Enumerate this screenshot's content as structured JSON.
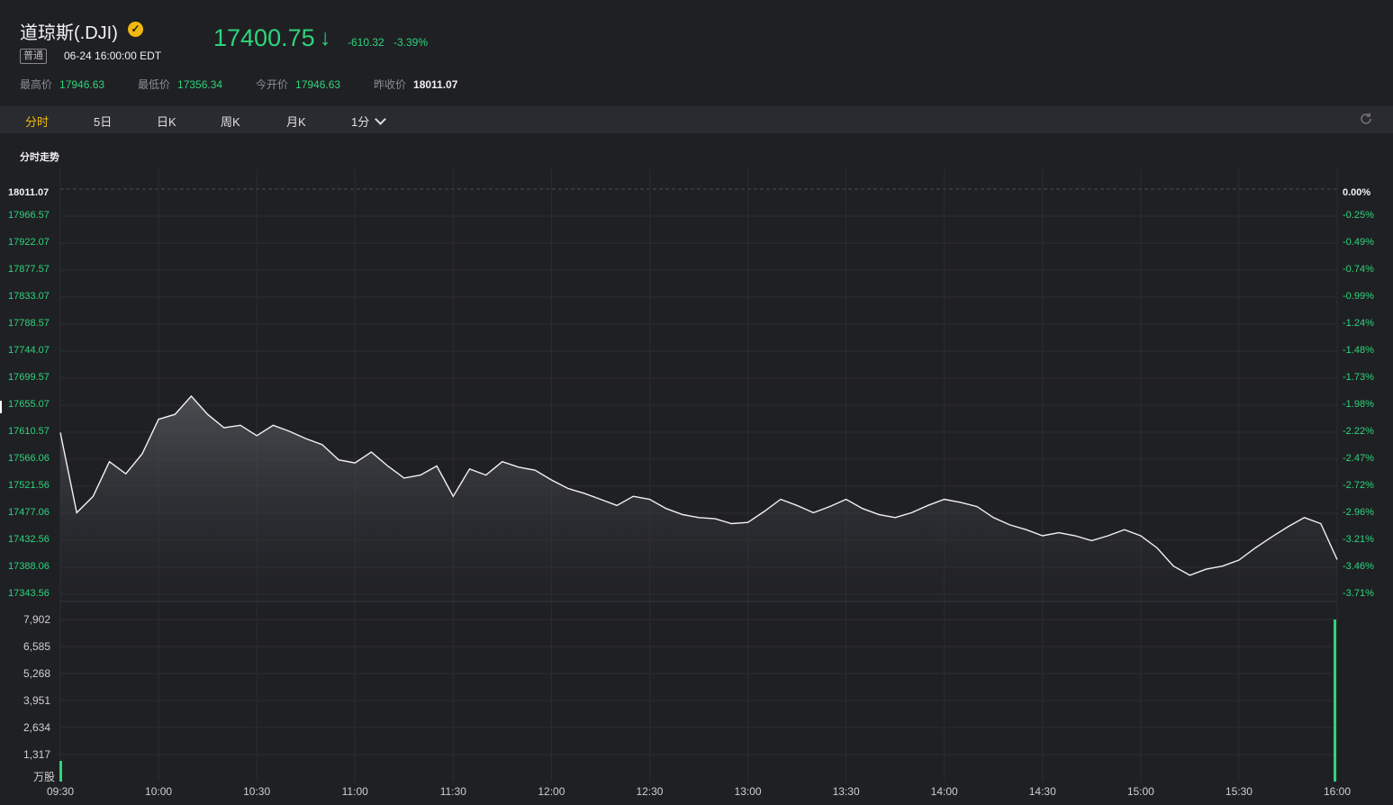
{
  "stock": {
    "name": "道琼斯(.DJI)",
    "tag": "普通",
    "datetime": "06-24 16:00:00 EDT",
    "price": "17400.75",
    "change": "-610.32",
    "change_pct": "-3.39%",
    "arrow": "↓"
  },
  "stats": [
    {
      "label": "最高价",
      "value": "17946.63"
    },
    {
      "label": "最低价",
      "value": "17356.34"
    },
    {
      "label": "今开价",
      "value": "17946.63"
    },
    {
      "label": "昨收价",
      "value": "18011.07"
    }
  ],
  "tabs": [
    {
      "label": "分时",
      "active": true
    },
    {
      "label": "5日"
    },
    {
      "label": "日K"
    },
    {
      "label": "周K"
    },
    {
      "label": "月K"
    },
    {
      "label": "1分"
    }
  ],
  "section_title": "分时走势",
  "icons": {
    "verified": "check-badge-icon",
    "refresh": "refresh-icon",
    "dropdown": "chevron-down-icon"
  },
  "colors": {
    "up": "#e8455a",
    "down": "#2ed47a",
    "accent": "#f0b90b"
  },
  "chart_data": {
    "type": "line",
    "price_ticks": [
      "18011.07",
      "17966.57",
      "17922.07",
      "17877.57",
      "17833.07",
      "17788.57",
      "17744.07",
      "17699.57",
      "17655.07",
      "17610.57",
      "17566.06",
      "17521.56",
      "17477.06",
      "17432.56",
      "17388.06",
      "17343.56"
    ],
    "pct_ticks": [
      "0.00%",
      "-0.25%",
      "-0.49%",
      "-0.74%",
      "-0.99%",
      "-1.24%",
      "-1.48%",
      "-1.73%",
      "-1.98%",
      "-2.22%",
      "-2.47%",
      "-2.72%",
      "-2.96%",
      "-3.21%",
      "-3.46%",
      "-3.71%"
    ],
    "volume_ticks": [
      "7,902",
      "6,585",
      "5,268",
      "3,951",
      "2,634",
      "1,317"
    ],
    "volume_unit": "万股",
    "x_ticks": [
      "09:30",
      "10:00",
      "10:30",
      "11:00",
      "11:30",
      "12:00",
      "12:30",
      "13:00",
      "13:30",
      "14:00",
      "14:30",
      "15:00",
      "15:30",
      "16:00"
    ],
    "prev_close": 18011.07,
    "ylim": [
      17320,
      18011.07
    ],
    "series": [
      {
        "x": [
          "09:30",
          "09:35",
          "09:40",
          "09:45",
          "09:50",
          "09:55",
          "10:00",
          "10:05",
          "10:10",
          "10:15",
          "10:20",
          "10:25",
          "10:30",
          "10:35",
          "10:40",
          "10:45",
          "10:50",
          "10:55",
          "11:00",
          "11:05",
          "11:10",
          "11:15",
          "11:20",
          "11:25",
          "11:30",
          "11:35",
          "11:40",
          "11:45",
          "11:50",
          "11:55",
          "12:00",
          "12:05",
          "12:10",
          "12:15",
          "12:20",
          "12:25",
          "12:30",
          "12:35",
          "12:40",
          "12:45",
          "12:50",
          "12:55",
          "13:00",
          "13:05",
          "13:10",
          "13:15",
          "13:20",
          "13:25",
          "13:30",
          "13:35",
          "13:40",
          "13:45",
          "13:50",
          "13:55",
          "14:00",
          "14:05",
          "14:10",
          "14:15",
          "14:20",
          "14:25",
          "14:30",
          "14:35",
          "14:40",
          "14:45",
          "14:50",
          "14:55",
          "15:00",
          "15:05",
          "15:10",
          "15:15",
          "15:20",
          "15:25",
          "15:30",
          "15:35",
          "15:40",
          "15:45",
          "15:50",
          "15:55",
          "16:00"
        ],
        "values": [
          17610,
          17478,
          17505,
          17562,
          17542,
          17575,
          17632,
          17640,
          17670,
          17640,
          17618,
          17622,
          17605,
          17622,
          17612,
          17600,
          17590,
          17565,
          17560,
          17578,
          17555,
          17535,
          17540,
          17555,
          17505,
          17550,
          17540,
          17562,
          17553,
          17548,
          17532,
          17518,
          17510,
          17500,
          17490,
          17505,
          17500,
          17485,
          17475,
          17470,
          17468,
          17460,
          17462,
          17480,
          17500,
          17490,
          17478,
          17488,
          17500,
          17485,
          17475,
          17470,
          17478,
          17490,
          17500,
          17495,
          17488,
          17470,
          17458,
          17450,
          17440,
          17445,
          17440,
          17432,
          17440,
          17450,
          17440,
          17420,
          17390,
          17375,
          17385,
          17390,
          17400,
          17420,
          17438,
          17455,
          17470,
          17460,
          17400.75
        ]
      }
    ],
    "volume": {
      "x": [
        "16:00"
      ],
      "values": [
        7902
      ]
    }
  }
}
